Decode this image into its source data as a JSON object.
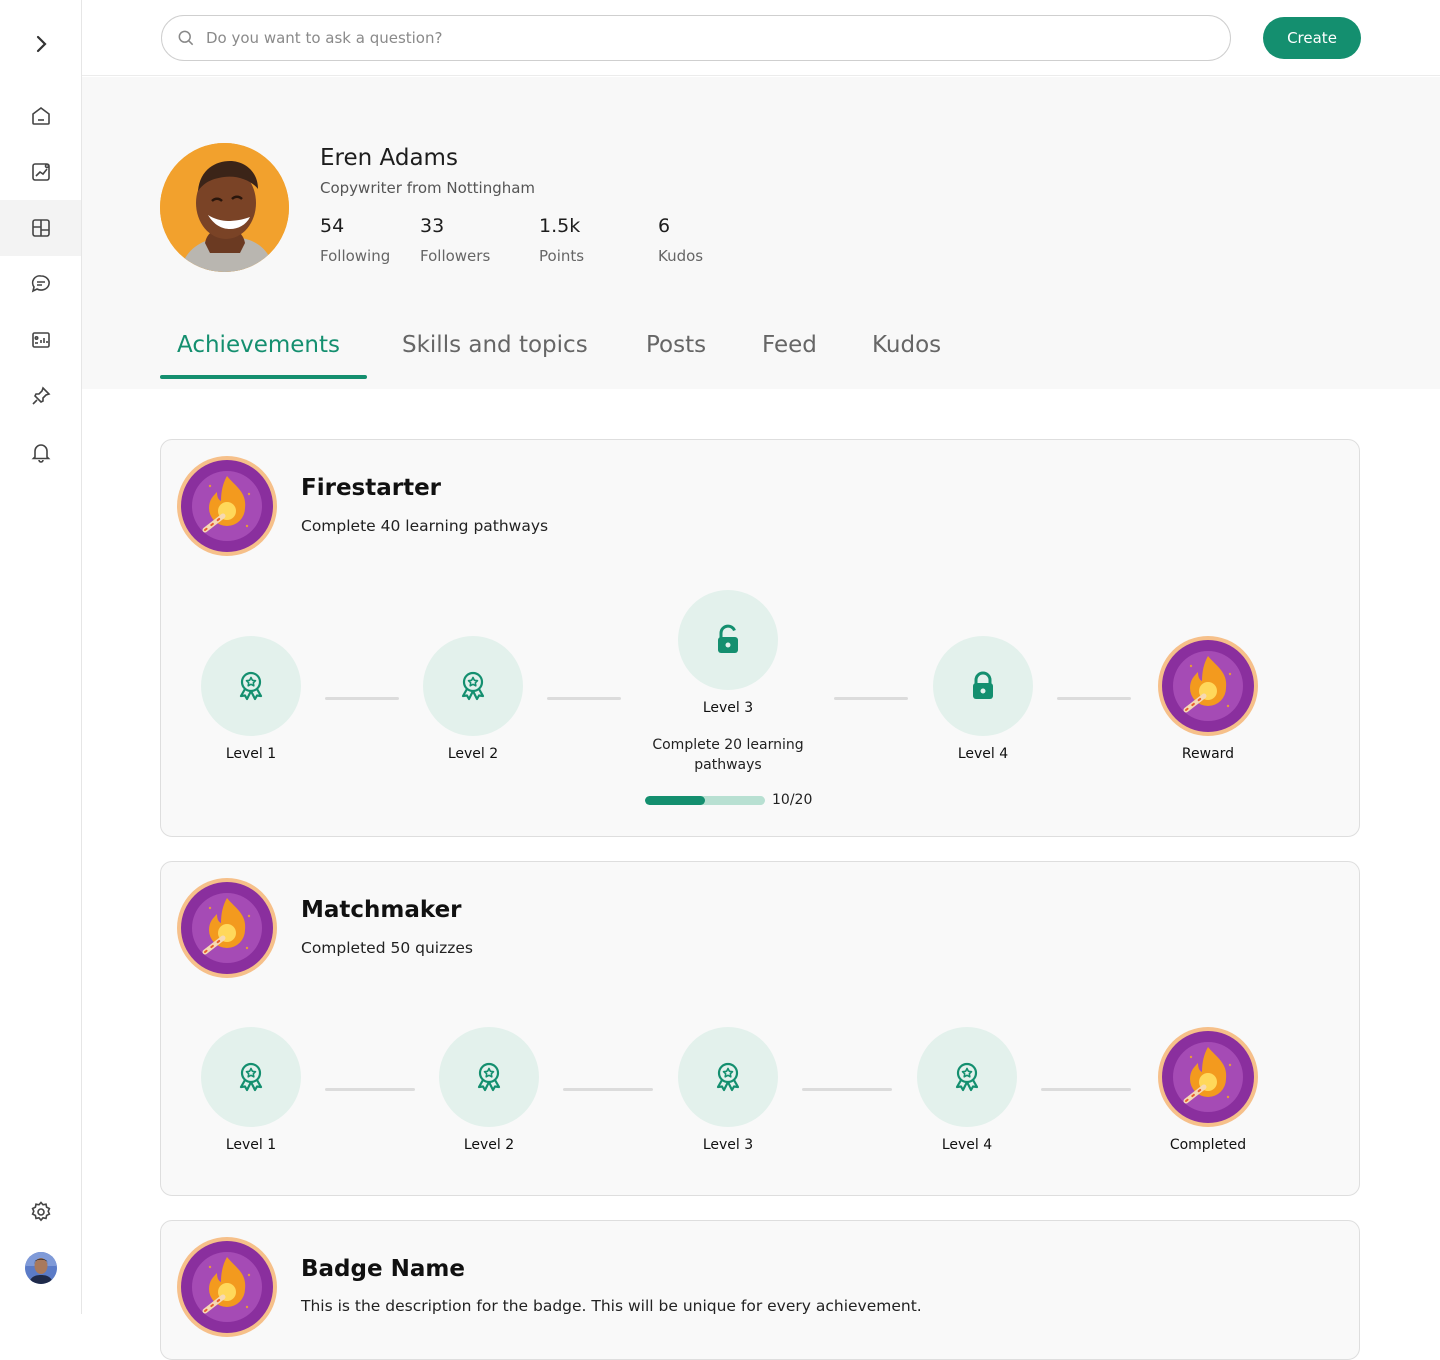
{
  "search": {
    "placeholder": "Do you want to ask a question?"
  },
  "header": {
    "create_label": "Create"
  },
  "profile": {
    "name": "Eren Adams",
    "subtitle": "Copywriter from Nottingham",
    "stats": [
      {
        "value": "54",
        "label": "Following"
      },
      {
        "value": "33",
        "label": "Followers"
      },
      {
        "value": "1.5k",
        "label": "Points"
      },
      {
        "value": "6",
        "label": "Kudos"
      }
    ]
  },
  "tabs": [
    {
      "label": "Achievements",
      "active": true
    },
    {
      "label": "Skills and topics"
    },
    {
      "label": "Posts"
    },
    {
      "label": "Feed"
    },
    {
      "label": "Kudos"
    }
  ],
  "sidebar": {
    "icons": [
      "chevron-right-icon",
      "home-icon",
      "analytics-icon",
      "dashboard-icon",
      "chat-icon",
      "report-icon",
      "pin-icon",
      "bell-icon",
      "settings-icon",
      "user-avatar"
    ]
  },
  "achievements": [
    {
      "title": "Firestarter",
      "description": "Complete 40 learning pathways",
      "levels": [
        {
          "label": "Level 1",
          "state": "done"
        },
        {
          "label": "Level 2",
          "state": "done"
        },
        {
          "label": "Level 3",
          "state": "current",
          "detail": "Complete 20 learning pathways",
          "progress_text": "10/20",
          "progress": 0.5
        },
        {
          "label": "Level 4",
          "state": "locked"
        },
        {
          "label": "Reward",
          "state": "reward"
        }
      ]
    },
    {
      "title": "Matchmaker",
      "description": "Completed 50 quizzes",
      "levels": [
        {
          "label": "Level 1",
          "state": "done"
        },
        {
          "label": "Level 2",
          "state": "done"
        },
        {
          "label": "Level 3",
          "state": "done"
        },
        {
          "label": "Level 4",
          "state": "done"
        },
        {
          "label": "Completed",
          "state": "reward"
        }
      ]
    },
    {
      "title": "Badge Name",
      "description": "This is the description for the badge. This will be unique for every achievement."
    }
  ],
  "colors": {
    "accent": "#148f6f",
    "accent_light": "#e3f1ec",
    "badge_purple": "#7a2a8f",
    "badge_orange": "#f39a1e"
  }
}
